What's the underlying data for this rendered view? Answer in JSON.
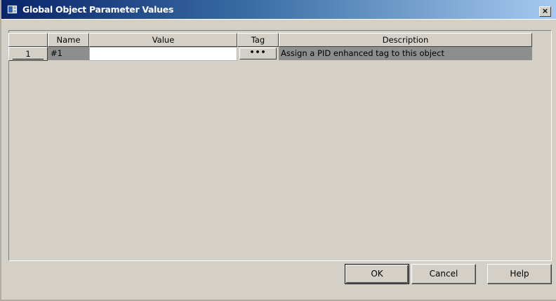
{
  "window": {
    "title": "Global Object Parameter Values",
    "close_label": "×"
  },
  "grid": {
    "columns": [
      "",
      "Name",
      "Value",
      "Tag",
      "Description"
    ],
    "rows": [
      {
        "number": "1",
        "name": "#1",
        "value": "",
        "tag_button": "•••",
        "description": "Assign a PID enhanced tag to this object"
      }
    ]
  },
  "buttons": {
    "ok": "OK",
    "cancel": "Cancel",
    "help": "Help"
  },
  "colors": {
    "titlebar_start": "#0a246a",
    "titlebar_end": "#a6caf0",
    "dialog_bg": "#d4d0c8",
    "selected_row": "#8e8e8e"
  }
}
